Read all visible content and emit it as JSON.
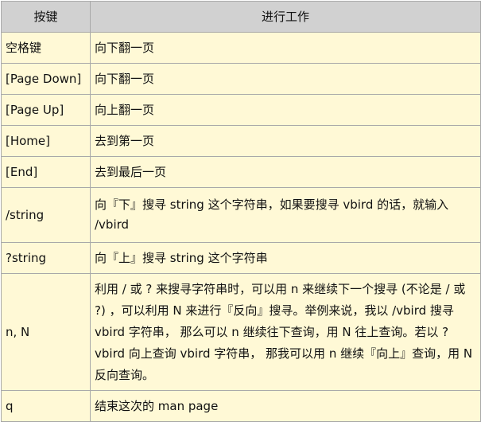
{
  "table": {
    "headers": [
      "按键",
      "进行工作"
    ],
    "rows": [
      {
        "key": "空格键",
        "action": "向下翻一页"
      },
      {
        "key": "[Page Down]",
        "action": "向下翻一页"
      },
      {
        "key": "[Page Up]",
        "action": "向上翻一页"
      },
      {
        "key": "[Home]",
        "action": "去到第一页"
      },
      {
        "key": "[End]",
        "action": "去到最后一页"
      },
      {
        "key": "/string",
        "action": "向『下』搜寻 string 这个字符串，如果要搜寻 vbird 的话，就输入 /vbird"
      },
      {
        "key": "?string",
        "action": "向『上』搜寻 string 这个字符串"
      },
      {
        "key": "n, N",
        "action": "利用 / 或 ? 来搜寻字符串时，可以用 n 来继续下一个搜寻 (不论是 / 或 ?) ，可以利用 N 来进行『反向』搜寻。举例来说，我以 /vbird 搜寻 vbird 字符串， 那么可以 n 继续往下查询，用 N 往上查询。若以 ?vbird 向上查询 vbird 字符串， 那我可以用 n 继续『向上』查询，用 N 反向查询。"
      },
      {
        "key": "q",
        "action": "结束这次的 man page"
      }
    ]
  }
}
